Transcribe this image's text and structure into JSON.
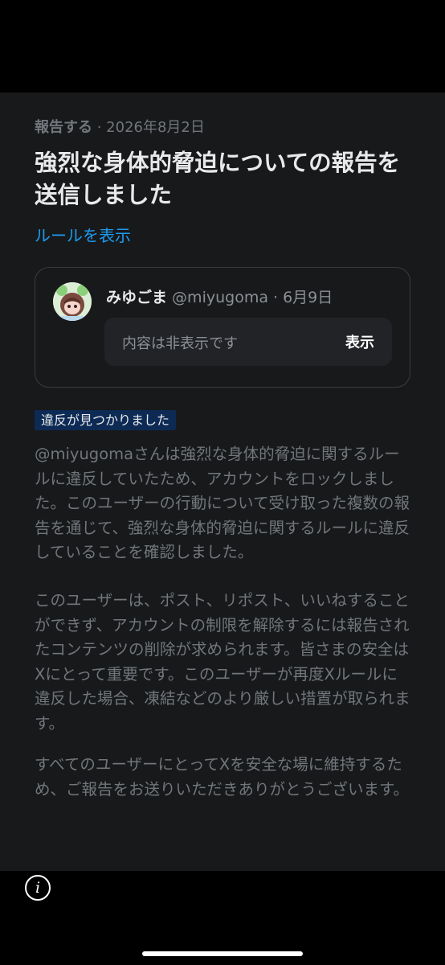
{
  "report": {
    "action": "報告する",
    "separator": " · ",
    "date": "2026年8月2日",
    "title": "強烈な身体的脅迫についての報告を送信しました",
    "rules_link": "ルールを表示"
  },
  "post": {
    "display_name": "みゆごま",
    "handle_and_date": " @miyugoma · 6月9日",
    "hidden_text": "内容は非表示です",
    "show_label": "表示"
  },
  "result": {
    "badge": "違反が見つかりました",
    "paragraphs": [
      "@miyugomaさんは強烈な身体的脅迫に関するルールに違反していたため、アカウントをロックしました。このユーザーの行動について受け取った複数の報告を通じて、強烈な身体的脅迫に関するルールに違反していることを確認しました。",
      "このユーザーは、ポスト、リポスト、いいねすることができず、アカウントの制限を解除するには報告されたコンテンツの削除が求められます。皆さまの安全はXにとって重要です。このユーザーが再度Xルールに違反した場合、凍結などのより厳しい措置が取られます。",
      "すべてのユーザーにとってXを安全な場に維持するため、ご報告をお送りいただきありがとうございます。"
    ]
  },
  "icons": {
    "info": "info-icon",
    "avatar": "avatar-image"
  },
  "colors": {
    "link": "#1d9bf0",
    "badge_bg": "#0d2a55",
    "panel_bg": "#18191b"
  }
}
